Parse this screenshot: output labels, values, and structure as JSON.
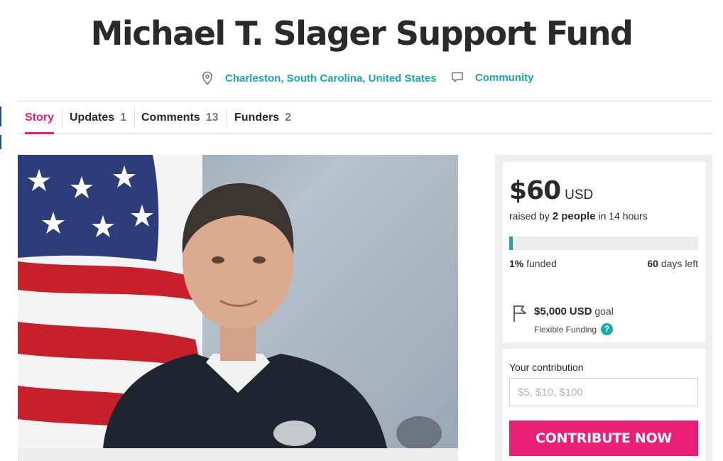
{
  "campaign": {
    "title": "Michael T. Slager Support Fund",
    "location": "Charleston, South Carolina, United States",
    "category": "Community",
    "location_icon": "map-pin-icon",
    "category_icon": "speech-bubble-icon"
  },
  "tabs": [
    {
      "label": "Story",
      "count": "",
      "active": true
    },
    {
      "label": "Updates",
      "count": "1",
      "active": false
    },
    {
      "label": "Comments",
      "count": "13",
      "active": false
    },
    {
      "label": "Funders",
      "count": "2",
      "active": false
    }
  ],
  "funding": {
    "amount": "$60",
    "currency": "USD",
    "raised_prefix": "raised by",
    "people": "2 people",
    "raised_suffix": "in 14 hours",
    "percent": "1%",
    "percent_label": "funded",
    "progress_fraction": 0.01,
    "days": "60",
    "days_label": "days left",
    "goal_amount": "$5,000",
    "goal_currency": "USD",
    "goal_label": "goal",
    "funding_type": "Flexible Funding",
    "goal_icon": "flag-icon",
    "help_glyph": "?"
  },
  "contribution": {
    "label": "Your contribution",
    "placeholder": "$5, $10, $100",
    "button_label": "CONTRIBUTE NOW"
  },
  "colors": {
    "accent_pink": "#e91f77",
    "accent_teal": "#1aa8ac",
    "text_dark": "#2a2a2a"
  }
}
